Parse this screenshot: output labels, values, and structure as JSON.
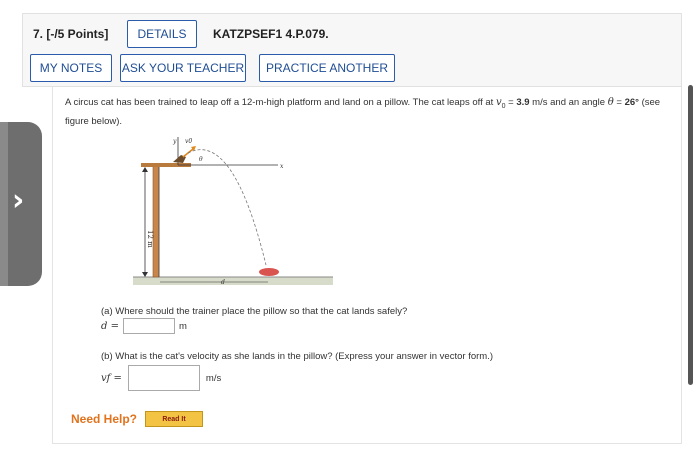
{
  "header": {
    "question_number": "7. [-/5 Points]",
    "details_label": "DETAILS",
    "question_code": "KATZPSEF1 4.P.079.",
    "my_notes_label": "MY NOTES",
    "ask_teacher_label": "ASK YOUR TEACHER",
    "practice_another_label": "PRACTICE ANOTHER"
  },
  "problem": {
    "text_1": "A circus cat has been trained to leap off a 12-m-high platform and land on a pillow. The cat leaps off at ",
    "v0_symbol": "v",
    "v0_sub": "0",
    "v0_eq": " = ",
    "v0_value": "3.9",
    "text_2": " m/s and an angle ",
    "theta_symbol": "θ",
    "theta_eq": " = ",
    "theta_value": "26°",
    "text_3": " (see figure below)."
  },
  "figure": {
    "height_label": "12 m",
    "d_label": "d",
    "x_label": "x",
    "y_label": "y",
    "v0_label": "v0",
    "theta_label": "θ"
  },
  "part_a": {
    "question": "(a) Where should the trainer place the pillow so that the cat lands safely?",
    "var_label": "d =",
    "value": "",
    "unit": "m"
  },
  "part_b": {
    "question": "(b) What is the cat's velocity as she lands in the pillow? (Express your answer in vector form.)",
    "var_label": "vf =",
    "value": "",
    "unit": "m/s"
  },
  "help": {
    "label": "Need Help?",
    "read_it_label": "Read It"
  }
}
